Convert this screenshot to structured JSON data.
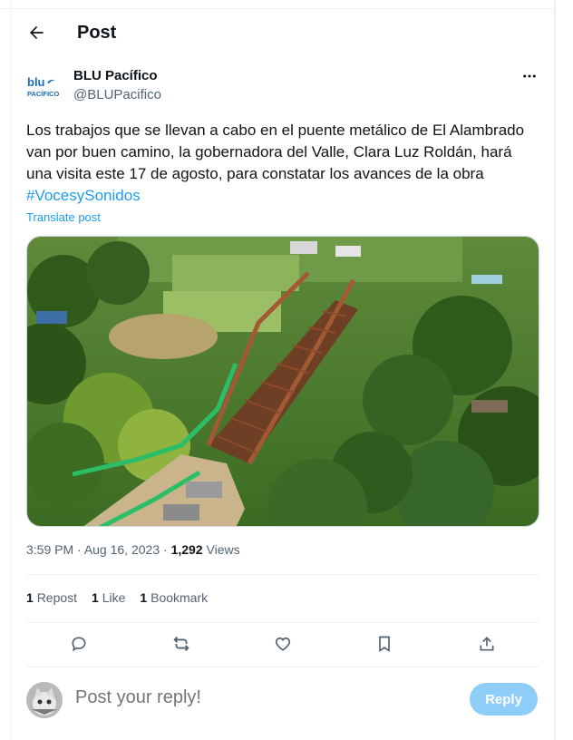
{
  "header": {
    "title": "Post"
  },
  "author": {
    "name": "BLU Pacífico",
    "handle": "@BLUPacifico",
    "logo_text_top": "blu",
    "logo_text_bottom": "PACÍFICO"
  },
  "post": {
    "text": "Los trabajos que se llevan a cabo en el puente metálico de El Alambrado van por buen camino, la gobernadora del Valle, Clara Luz Roldán, hará una visita este 17 de agosto, para constatar los avances de la obra",
    "hashtag": "#VocesySonidos",
    "translate_label": "Translate post",
    "time": "3:59 PM",
    "date": "Aug 16, 2023",
    "views_count": "1,292",
    "views_label": "Views"
  },
  "stats": [
    {
      "count": "1",
      "label": "Repost"
    },
    {
      "count": "1",
      "label": "Like"
    },
    {
      "count": "1",
      "label": "Bookmark"
    }
  ],
  "reply": {
    "placeholder": "Post your reply!",
    "button_label": "Reply"
  },
  "icons": [
    "back-arrow-icon",
    "more-icon",
    "reply-icon",
    "repost-icon",
    "like-icon",
    "bookmark-icon",
    "share-icon"
  ],
  "colors": {
    "accent": "#1d9bf0",
    "muted": "#536471",
    "reply_button": "#8ecdf7",
    "logo": "#1a6fb5"
  }
}
